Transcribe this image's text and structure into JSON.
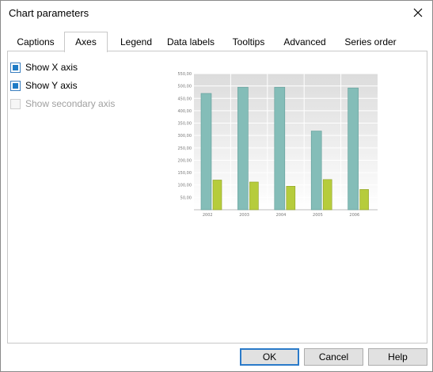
{
  "window": {
    "title": "Chart parameters"
  },
  "tabs": [
    {
      "label": "Captions"
    },
    {
      "label": "Axes"
    },
    {
      "label": "Legend"
    },
    {
      "label": "Data labels"
    },
    {
      "label": "Tooltips"
    },
    {
      "label": "Advanced"
    },
    {
      "label": "Series order"
    }
  ],
  "active_tab": "Axes",
  "options": {
    "show_x_axis": {
      "label": "Show X axis",
      "checked": true,
      "enabled": true
    },
    "show_y_axis": {
      "label": "Show Y axis",
      "checked": true,
      "enabled": true
    },
    "show_secondary_axis": {
      "label": "Show secondary axis",
      "checked": false,
      "enabled": false
    }
  },
  "buttons": {
    "ok": "OK",
    "cancel": "Cancel",
    "help": "Help"
  },
  "colors": {
    "series_1": "#84bdb8",
    "series_2": "#b6cc3c",
    "checkbox_accent": "#1e7bc6",
    "primary_button_border": "#2a7ac9"
  },
  "chart_data": {
    "type": "bar",
    "categories": [
      "2002",
      "2003",
      "2004",
      "2005",
      "2006"
    ],
    "series": [
      {
        "values": [
          470,
          495,
          495,
          318,
          492
        ]
      },
      {
        "values": [
          120,
          112,
          95,
          122,
          82
        ]
      }
    ],
    "ylim": [
      0,
      550
    ],
    "yticks": [
      "50,00",
      "100,00",
      "150,00",
      "200,00",
      "250,00",
      "300,00",
      "350,00",
      "400,00",
      "450,00",
      "500,00",
      "550,00"
    ],
    "grid": true
  }
}
